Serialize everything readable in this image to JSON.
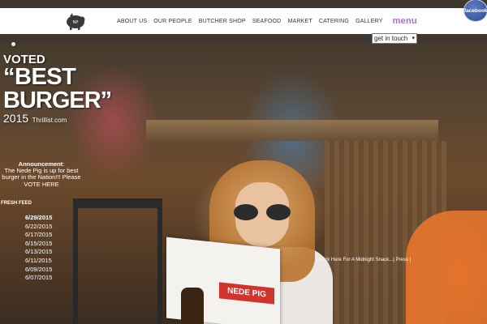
{
  "header": {
    "nav": [
      {
        "label": "ABOUT US"
      },
      {
        "label": "OUR PEOPLE"
      },
      {
        "label": "BUTCHER SHOP"
      },
      {
        "label": "SEAFOOD"
      },
      {
        "label": "MARKET"
      },
      {
        "label": "CATERING"
      },
      {
        "label": "GALLERY"
      }
    ],
    "menu_label": "menu",
    "get_in_touch": "get in touch",
    "facebook_label": "facebook"
  },
  "badge": {
    "line1": "VOTED",
    "line2": "“BEST",
    "line3": "BURGER”",
    "year": "2015",
    "source": "Thrillist.com"
  },
  "announcement": {
    "title": "Announcement",
    "body": "The Nede Pig is up for best burger in the Nation!!! Please",
    "link": "VOTE HERE"
  },
  "feed": {
    "title": "FRESH FEED",
    "dates": [
      "6/29/2015",
      "6/22/2015",
      "6/17/2015",
      "6/15/2015",
      "6/13/2015",
      "6/11/2015",
      "6/09/2015",
      "6/07/2015"
    ]
  },
  "ticker": "| Click Here For A Midnight Snack...| Press |",
  "menu_card_title": "NEDE PIG",
  "colors": {
    "menu_accent": "#b06ad0",
    "facebook": "#2d4a8f"
  }
}
